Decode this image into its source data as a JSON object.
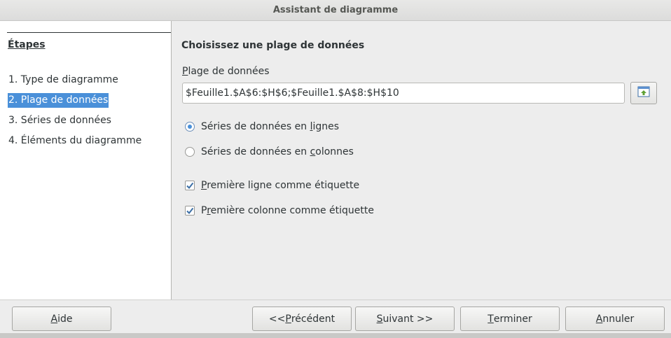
{
  "window": {
    "title": "Assistant de diagramme"
  },
  "sidebar": {
    "heading": "Étapes",
    "steps": [
      {
        "label": "1. Type de diagramme"
      },
      {
        "label": "2. Plage de données",
        "selected": true
      },
      {
        "label": "3. Séries de données"
      },
      {
        "label": "4. Éléments du diagramme"
      }
    ]
  },
  "main": {
    "title": "Choisissez une plage de données",
    "range_label_mn": "P",
    "range_label_rest": "lage de données",
    "range_value": "$Feuille1.$A$6:$H$6;$Feuille1.$A$8:$H$10",
    "shrink_icon": "shrink-dialog-icon",
    "radio_rows": {
      "pre": "Séries de données en ",
      "mn": "l",
      "post": "ignes",
      "checked": true
    },
    "radio_cols": {
      "pre": "Séries de données en ",
      "mn": "c",
      "post": "olonnes",
      "checked": false
    },
    "check_first_row": {
      "pre": "",
      "mn": "P",
      "post": "remière ligne comme étiquette",
      "checked": true
    },
    "check_first_col": {
      "pre": "P",
      "mn": "r",
      "post": "emière colonne comme étiquette",
      "checked": true
    }
  },
  "buttons": {
    "help": {
      "mn": "A",
      "post": "ide"
    },
    "previous": {
      "pre": "<< ",
      "mn": "P",
      "post": "récédent"
    },
    "next": {
      "mn": "S",
      "post": "uivant >>"
    },
    "finish": {
      "mn": "T",
      "post": "erminer"
    },
    "cancel": {
      "mn": "A",
      "post": "nnuler"
    }
  },
  "colors": {
    "accent": "#4a90d9",
    "selection_text": "#ffffff"
  }
}
